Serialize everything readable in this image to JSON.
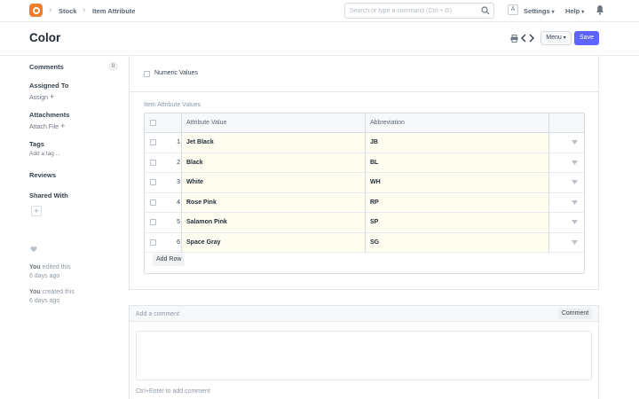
{
  "nav": {
    "breadcrumbs": [
      "Stock",
      "Item Attribute"
    ],
    "search_placeholder": "Search or type a command (Ctrl + G)",
    "avatar_letter": "A",
    "settings_label": "Settings",
    "help_label": "Help"
  },
  "page": {
    "title": "Color",
    "menu_label": "Menu",
    "save_label": "Save"
  },
  "sidebar": {
    "comments_label": "Comments",
    "comments_count": "0",
    "assigned_to_label": "Assigned To",
    "assign_link": "Assign",
    "attachments_label": "Attachments",
    "attach_link": "Attach File",
    "tags_label": "Tags",
    "add_tag_link": "Add a tag ...",
    "reviews_label": "Reviews",
    "shared_with_label": "Shared With",
    "activity": [
      {
        "who": "You",
        "action": "edited this",
        "when": "6 days ago"
      },
      {
        "who": "You",
        "action": "created this",
        "when": "6 days ago"
      }
    ]
  },
  "form": {
    "numeric_values_label": "Numeric Values",
    "numeric_values_checked": false,
    "section_label": "Item Attribute Values",
    "table": {
      "columns": [
        "Attribute Value",
        "Abbreviation"
      ],
      "rows": [
        {
          "idx": "1",
          "value": "Jet Black",
          "abbr": "JB"
        },
        {
          "idx": "2",
          "value": "Black",
          "abbr": "BL"
        },
        {
          "idx": "3",
          "value": "White",
          "abbr": "WH"
        },
        {
          "idx": "4",
          "value": "Rose Pink",
          "abbr": "RP"
        },
        {
          "idx": "5",
          "value": "Salamon Pink",
          "abbr": "SP"
        },
        {
          "idx": "6",
          "value": "Space Gray",
          "abbr": "SG"
        }
      ]
    },
    "add_row_label": "Add Row"
  },
  "comment": {
    "placeholder": "Add a comment",
    "button_label": "Comment",
    "hint": "Ctrl+Enter to add comment"
  },
  "colors": {
    "brand": "#f07b2a",
    "primary": "#5e64ff",
    "editable_cell": "#fffdf0"
  }
}
